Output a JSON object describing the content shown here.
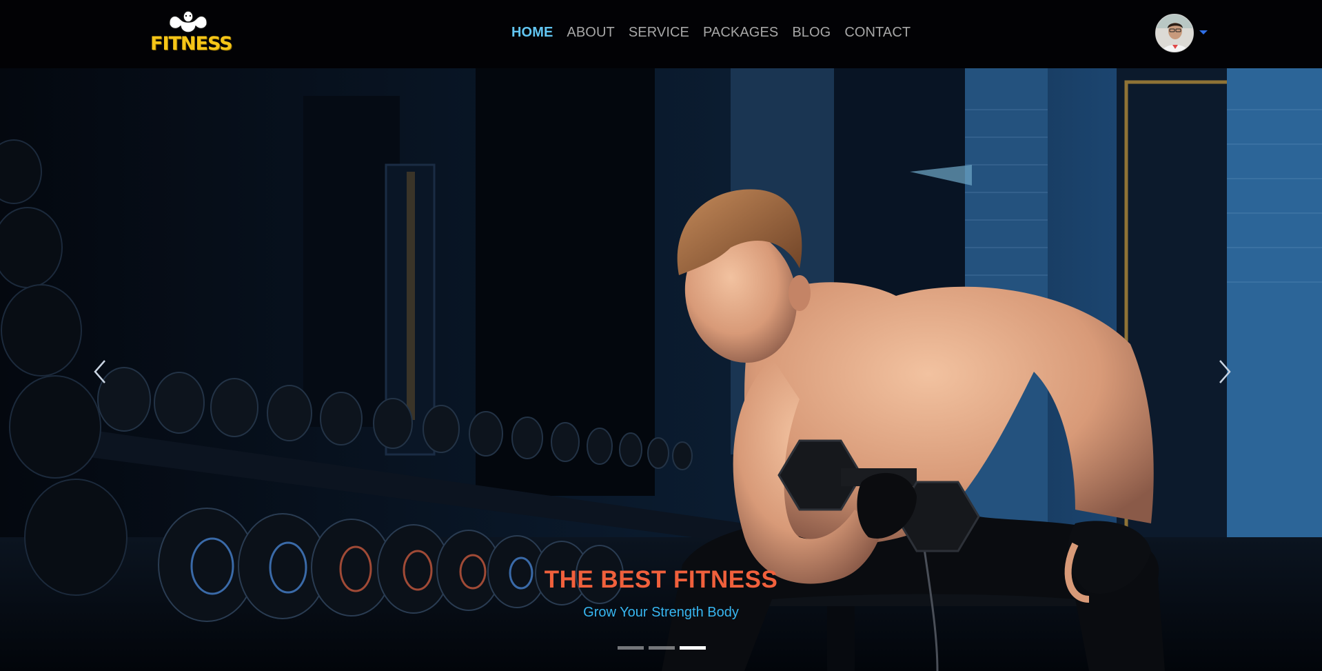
{
  "brand": {
    "logo_text": "FITNESS",
    "logo_color": "#f5c518"
  },
  "nav": {
    "items": [
      {
        "label": "HOME",
        "active": true
      },
      {
        "label": "ABOUT",
        "active": false
      },
      {
        "label": "SERVICE",
        "active": false
      },
      {
        "label": "PACKAGES",
        "active": false
      },
      {
        "label": "BLOG",
        "active": false
      },
      {
        "label": "CONTACT",
        "active": false
      }
    ],
    "active_color": "#62c6f2",
    "inactive_color": "#a7a7a7"
  },
  "user_menu": {
    "icon": "avatar",
    "caret_icon": "caret-down-icon",
    "caret_color": "#2f6fe6"
  },
  "hero": {
    "title": "THE BEST FITNESS",
    "subtitle": "Grow Your Strength Body",
    "title_color": "#f0603c",
    "subtitle_color": "#37b6f0",
    "prev_icon": "chevron-left-icon",
    "next_icon": "chevron-right-icon",
    "slides": 3,
    "active_slide": 3
  }
}
